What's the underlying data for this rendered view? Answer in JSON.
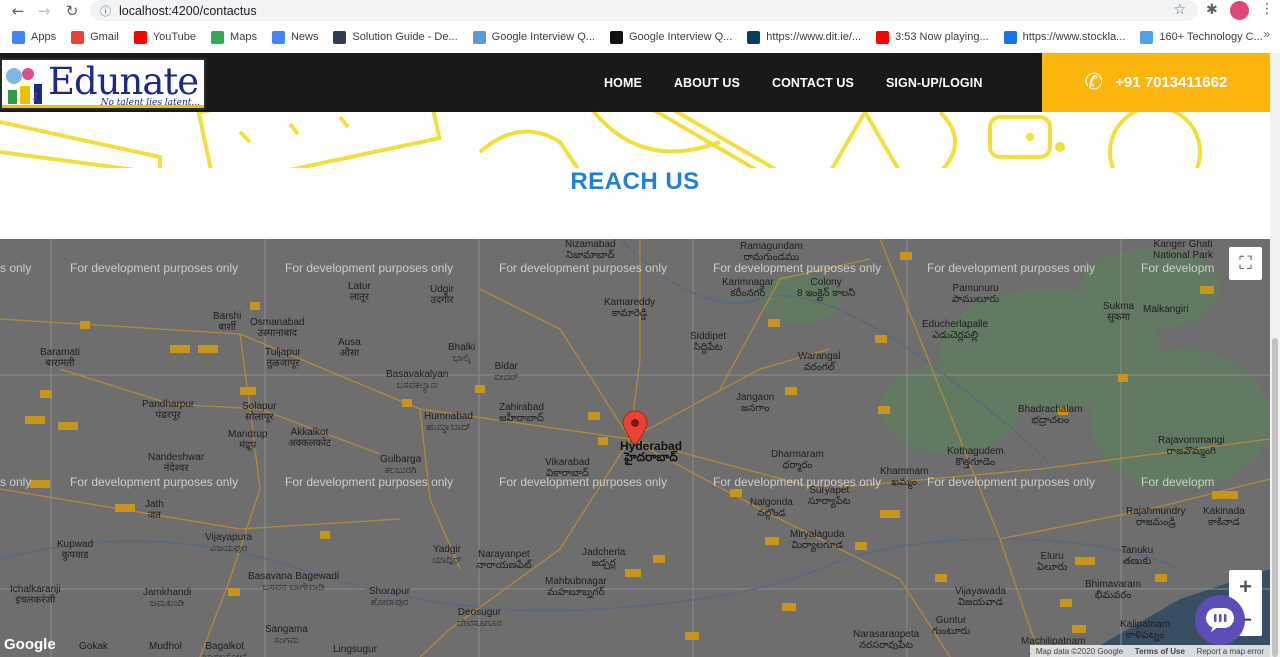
{
  "browser": {
    "url": "localhost:4200/contactus",
    "bookmarks": [
      {
        "label": "Apps",
        "icon": "apps-icon",
        "color": "#4285f4"
      },
      {
        "label": "Gmail",
        "icon": "gmail-icon",
        "color": "#ea4335"
      },
      {
        "label": "YouTube",
        "icon": "youtube-icon",
        "color": "#ff0000"
      },
      {
        "label": "Maps",
        "icon": "maps-icon",
        "color": "#34a853"
      },
      {
        "label": "News",
        "icon": "news-icon",
        "color": "#4285f4"
      },
      {
        "label": "Solution Guide - De...",
        "icon": "h-icon",
        "color": "#2c3e50"
      },
      {
        "label": "Google Interview Q...",
        "icon": "doc-icon",
        "color": "#5b9bd5"
      },
      {
        "label": "Google Interview Q...",
        "icon": "a-icon",
        "color": "#111111"
      },
      {
        "label": "https://www.dit.ie/...",
        "icon": "dit-icon",
        "color": "#0b3d5c"
      },
      {
        "label": "3:53 Now playing...",
        "icon": "youtube-icon",
        "color": "#ff0000"
      },
      {
        "label": "https://www.stockla...",
        "icon": "stock-icon",
        "color": "#1a73e8"
      },
      {
        "label": "160+ Technology C...",
        "icon": "tech-icon",
        "color": "#4fa3e0"
      }
    ],
    "more": "»"
  },
  "site": {
    "logo_text": "Edunate",
    "logo_tagline": "No talent lies latent...",
    "nav": [
      "HOME",
      "ABOUT US",
      "CONTACT US",
      "SIGN-UP/LOGIN"
    ],
    "phone": "+91 7013411662",
    "accent": "#fbb50c",
    "section_title": "REACH US"
  },
  "map": {
    "watermark": "For development purposes only",
    "watermark_partial_left": "s only",
    "watermark_partial_right": "For developm",
    "cities": [
      {
        "name": "Nizamabad",
        "sub": "నిజామాబాద్"
      },
      {
        "name": "Ramagundam",
        "sub": "రామగుండము"
      },
      {
        "name": "Kanger Ghati",
        "sub": "National Park"
      },
      {
        "name": "Latur",
        "sub": "लातूर"
      },
      {
        "name": "Udgir",
        "sub": "उदगीर"
      },
      {
        "name": "Karimnagar",
        "sub": "కరీంనగర్"
      },
      {
        "name": "Colony",
        "sub": "8 ఇంక్లైన్ కాలనీ"
      },
      {
        "name": "Pamunuru",
        "sub": "పాములూరు"
      },
      {
        "name": "Sukma",
        "sub": "सुकमा"
      },
      {
        "name": "Malkangiri",
        "sub": ""
      },
      {
        "name": "Barshi",
        "sub": "बार्शी"
      },
      {
        "name": "Osmanabad",
        "sub": "उस्मानाबाद"
      },
      {
        "name": "Ausa",
        "sub": "औसा"
      },
      {
        "name": "Bhalki",
        "sub": "ಭಾಲ್ಕಿ"
      },
      {
        "name": "Kamareddy",
        "sub": "కామారెడ్డి"
      },
      {
        "name": "Siddipet",
        "sub": "సిద్దిపేట"
      },
      {
        "name": "Educherlapalle",
        "sub": "ఎడుచెర్లపల్లి"
      },
      {
        "name": "Baramati",
        "sub": "बारामती"
      },
      {
        "name": "Tuljapur",
        "sub": "तुळजापूर"
      },
      {
        "name": "Bidar",
        "sub": "ಬೀದರ್"
      },
      {
        "name": "Warangal",
        "sub": "వరంగల్"
      },
      {
        "name": "Basavakalyan",
        "sub": "ಬಸವಕಲ್ಯಾಣ"
      },
      {
        "name": "Pandharpur",
        "sub": "पंढरपूर"
      },
      {
        "name": "Solapur",
        "sub": "सोलापूर"
      },
      {
        "name": "Humnabad",
        "sub": "ಹುಮ್ನಾಬಾದ್"
      },
      {
        "name": "Zahirabad",
        "sub": "జహీరాబాద్"
      },
      {
        "name": "Jangaon",
        "sub": "జనగాం"
      },
      {
        "name": "Bhadrachalam",
        "sub": "భద్రాచలం"
      },
      {
        "name": "Mandrup",
        "sub": "मंद्रूप"
      },
      {
        "name": "Akkalkot",
        "sub": "अक्कलकोट"
      },
      {
        "name": "Hyderabad",
        "sub": "హైదరాబాద్"
      },
      {
        "name": "Dharmaram",
        "sub": "ధర్మారం"
      },
      {
        "name": "Kothagudem",
        "sub": "కొత్తగూడెం"
      },
      {
        "name": "Rajavommangi",
        "sub": "రాజవొమ్మంగి"
      },
      {
        "name": "Nandeshwar",
        "sub": "नंदेश्वर"
      },
      {
        "name": "Gulbarga",
        "sub": "ಕಲಬುರಗಿ"
      },
      {
        "name": "Vikarabad",
        "sub": "వికారాబాద్"
      },
      {
        "name": "Khammam",
        "sub": "ఖమ్మం"
      },
      {
        "name": "Suryapet",
        "sub": "సూర్యాపేట"
      },
      {
        "name": "Nalgonda",
        "sub": "నల్గొండ"
      },
      {
        "name": "Rajahmundry",
        "sub": "రాజమండ్రి"
      },
      {
        "name": "Kakinada",
        "sub": "కాకినాడ"
      },
      {
        "name": "Jath",
        "sub": "जत"
      },
      {
        "name": "Kupwad",
        "sub": "कुपवाड"
      },
      {
        "name": "Vijayapura",
        "sub": "ವಿಜಯಪುರ"
      },
      {
        "name": "Yadgir",
        "sub": "ಯಾದ್ಗಿರ್"
      },
      {
        "name": "Narayanpet",
        "sub": "నారాయణపేట్"
      },
      {
        "name": "Jadcherla",
        "sub": "జడ్చర్ల"
      },
      {
        "name": "Miryalaguda",
        "sub": "మిర్యాలగూడ"
      },
      {
        "name": "Eluru",
        "sub": "ఏలూరు"
      },
      {
        "name": "Tanuku",
        "sub": "తణుకు"
      },
      {
        "name": "Mahbubnagar",
        "sub": "మహబూబ్నగర్"
      },
      {
        "name": "Bhimavaram",
        "sub": "భీమవరం"
      },
      {
        "name": "Vijayawada",
        "sub": "విజయవాడ"
      },
      {
        "name": "Ichalkaranji",
        "sub": "इचलकरंजी"
      },
      {
        "name": "Jamkhandi",
        "sub": "ಜಮಖಂಡಿ"
      },
      {
        "name": "Shorapur",
        "sub": "ಶೋರಾಪುರ"
      },
      {
        "name": "Deosugur",
        "sub": "ದೇವಸೂಗೂರ"
      },
      {
        "name": "Guntur",
        "sub": "గుంటూరు"
      },
      {
        "name": "Narasaraopeta",
        "sub": "నరసరావుపేట"
      },
      {
        "name": "Machilipatnam",
        "sub": "మచిలీపట్నం"
      },
      {
        "name": "Kalipatnam",
        "sub": "కాళిపట్నం"
      },
      {
        "name": "Gokak",
        "sub": ""
      },
      {
        "name": "Mudhol",
        "sub": ""
      },
      {
        "name": "Bagalkot",
        "sub": "ಬಾಗಲಕೋಟೆ"
      },
      {
        "name": "Sangama",
        "sub": "ಸಂಗಮ"
      },
      {
        "name": "Lingsugur",
        "sub": ""
      },
      {
        "name": "Basavana Bagewadi",
        "sub": "ಬಸವನ ಬಾಗೇವಾಡಿ"
      }
    ],
    "footer": [
      "Map data ©2020 Google",
      "Terms of Use",
      "Report a map error"
    ],
    "google": "Google"
  }
}
